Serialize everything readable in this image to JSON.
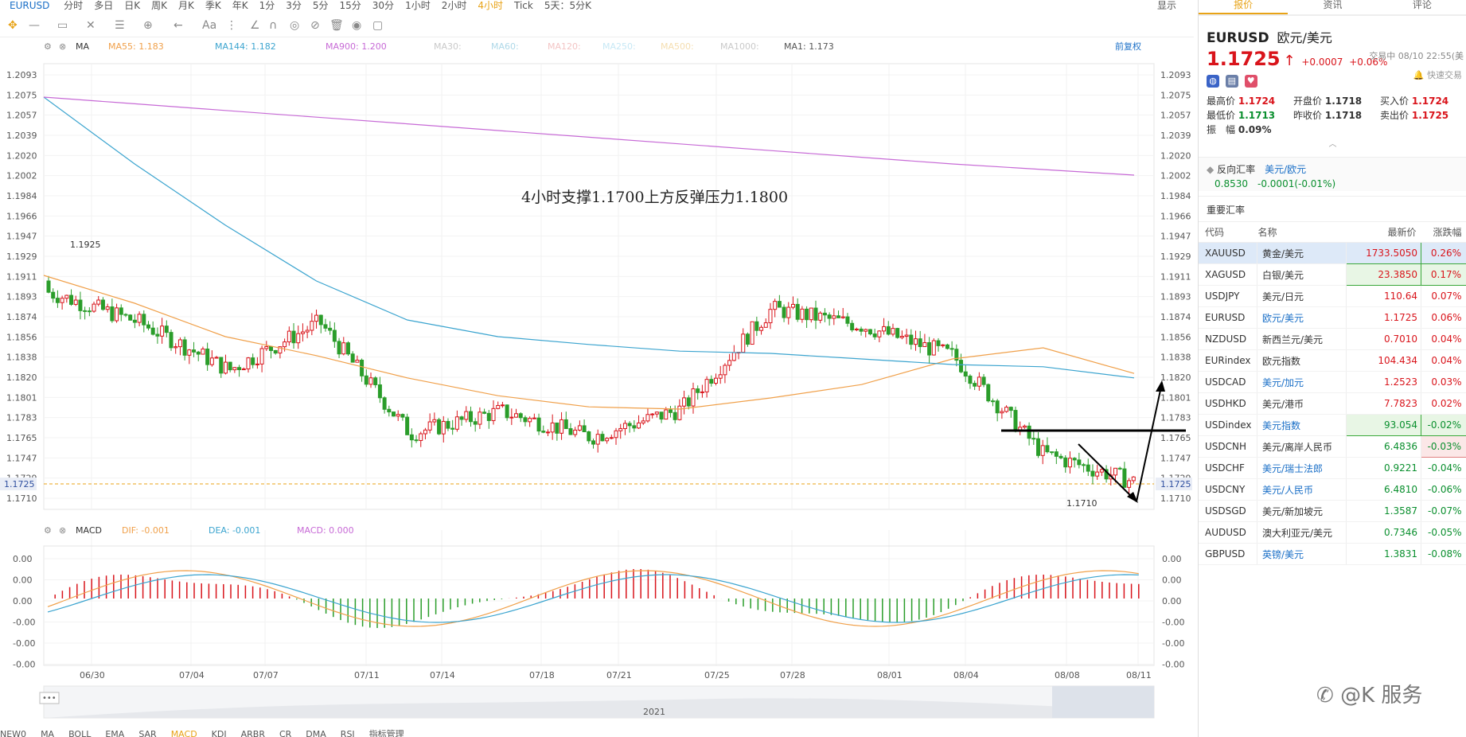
{
  "toolbar": {
    "symbol": "EURUSD",
    "periods": [
      "分时",
      "多日",
      "日K",
      "周K",
      "月K",
      "季K",
      "年K",
      "1分",
      "3分",
      "5分",
      "15分",
      "30分",
      "1小时",
      "2小时",
      "4小时",
      "Tick",
      "5天：5分K"
    ],
    "active_period": "4小时",
    "display_label": "显示"
  },
  "chart": {
    "ma_label": "MA",
    "ma55": "MA55: 1.183",
    "ma144": "MA144: 1.182",
    "ma900": "MA900: 1.200",
    "ma30": "MA30:",
    "ma60": "MA60:",
    "ma120": "MA120:",
    "ma250": "MA250:",
    "ma500": "MA500:",
    "ma1000": "MA1000:",
    "ma1": "MA1: 1.173",
    "adjust_label": "前复权",
    "annotation": "4小时支撑1.1700上方反弹压力1.1800",
    "price_ticks": [
      "1.2093",
      "1.2075",
      "1.2057",
      "1.2039",
      "1.2020",
      "1.2002",
      "1.1984",
      "1.1966",
      "1.1947",
      "1.1929",
      "1.1911",
      "1.1893",
      "1.1874",
      "1.1856",
      "1.1838",
      "1.1820",
      "1.1801",
      "1.1783",
      "1.1765",
      "1.1747",
      "1.1729",
      "1.1710"
    ],
    "current_price": "1.1725",
    "high_label": "1.1925",
    "low_label": "1.1710",
    "date_ticks": [
      "06/30",
      "07/04",
      "07/07",
      "07/11",
      "07/14",
      "07/18",
      "07/21",
      "07/25",
      "07/28",
      "08/01",
      "08/04",
      "08/08",
      "08/11"
    ],
    "year_label": "2021",
    "macd_label": "MACD",
    "dif": "DIF: -0.001",
    "dea": "DEA: -0.001",
    "macd": "MACD: 0.000",
    "macd_ticks": [
      "0.00",
      "0.00",
      "0.00",
      "-0.00",
      "-0.00",
      "-0.00"
    ]
  },
  "chart_data": {
    "type": "candlestick",
    "symbol": "EURUSD",
    "ylim": [
      1.17,
      1.21
    ],
    "x": [
      "06/30",
      "07/04",
      "07/07",
      "07/11",
      "07/14",
      "07/18",
      "07/21",
      "07/25",
      "07/28",
      "08/01",
      "08/04",
      "08/08",
      "08/11"
    ],
    "close": [
      1.1895,
      1.1868,
      1.1825,
      1.1868,
      1.1768,
      1.1788,
      1.1765,
      1.179,
      1.188,
      1.1865,
      1.1838,
      1.175,
      1.1725
    ],
    "series": [
      {
        "name": "MA55",
        "values": [
          1.191,
          1.1885,
          1.1855,
          1.1838,
          1.1818,
          1.1802,
          1.1792,
          1.179,
          1.18,
          1.1812,
          1.1835,
          1.1845,
          1.1822
        ]
      },
      {
        "name": "MA144",
        "values": [
          1.207,
          1.201,
          1.1955,
          1.1905,
          1.187,
          1.1855,
          1.1848,
          1.1842,
          1.184,
          1.1835,
          1.183,
          1.1828,
          1.1818
        ]
      },
      {
        "name": "MA900",
        "values": [
          1.207,
          1.2064,
          1.2058,
          1.2052,
          1.2046,
          1.204,
          1.2034,
          1.2028,
          1.2022,
          1.2016,
          1.201,
          1.2005,
          1.2
        ]
      }
    ],
    "colors": {
      "up": "#d9141b",
      "down": "#2a9d2a",
      "ma55": "#f0a04a",
      "ma144": "#3ba4cf",
      "ma900": "#c76ad6",
      "ma1": "#f5c542"
    }
  },
  "bottombar": [
    "NEW0",
    "MA",
    "BOLL",
    "EMA",
    "SAR",
    "MACD",
    "KDJ",
    "ARBR",
    "CR",
    "DMA",
    "RSI",
    "指标管理"
  ],
  "bottom_active": "MACD",
  "panel": {
    "tabs": [
      "报价",
      "资讯",
      "评论"
    ],
    "active_tab": "报价",
    "symbol": "EURUSD",
    "name": "欧元/美元",
    "price": "1.1725",
    "change": "+0.0007",
    "change_pct": "+0.06%",
    "time": "交易中 08/10 22:55(美",
    "fast_trade": "快速交易",
    "stats": [
      {
        "k": "最高价",
        "v": "1.1724",
        "c": "red"
      },
      {
        "k": "开盘价",
        "v": "1.1718",
        "c": "black"
      },
      {
        "k": "买入价",
        "v": "1.1724",
        "c": "red"
      },
      {
        "k": "最低价",
        "v": "1.1713",
        "c": "green"
      },
      {
        "k": "昨收价",
        "v": "1.1718",
        "c": "black"
      },
      {
        "k": "卖出价",
        "v": "1.1725",
        "c": "red"
      }
    ],
    "amp_label": "振　幅",
    "amp": "0.09%",
    "reverse_label": "反向汇率",
    "reverse_pair": "美元/欧元",
    "reverse_price": "0.8530",
    "reverse_change": "-0.0001(-0.01%)",
    "rates_title": "重要汇率",
    "table_headers": [
      "代码",
      "名称",
      "最新价",
      "涨跌幅"
    ],
    "rates": [
      {
        "code": "XAUUSD",
        "name": "黄金/美元",
        "price": "1733.5050",
        "pct": "0.26%",
        "dir": "up",
        "link": false
      },
      {
        "code": "XAGUSD",
        "name": "白银/美元",
        "price": "23.3850",
        "pct": "0.17%",
        "dir": "up",
        "link": false
      },
      {
        "code": "USDJPY",
        "name": "美元/日元",
        "price": "110.64",
        "pct": "0.07%",
        "dir": "up",
        "link": false
      },
      {
        "code": "EURUSD",
        "name": "欧元/美元",
        "price": "1.1725",
        "pct": "0.06%",
        "dir": "up",
        "link": true
      },
      {
        "code": "NZDUSD",
        "name": "新西兰元/美元",
        "price": "0.7010",
        "pct": "0.04%",
        "dir": "up",
        "link": false
      },
      {
        "code": "EURindex",
        "name": "欧元指数",
        "price": "104.434",
        "pct": "0.04%",
        "dir": "up",
        "link": false
      },
      {
        "code": "USDCAD",
        "name": "美元/加元",
        "price": "1.2523",
        "pct": "0.03%",
        "dir": "up",
        "link": true
      },
      {
        "code": "USDHKD",
        "name": "美元/港币",
        "price": "7.7823",
        "pct": "0.02%",
        "dir": "up",
        "link": false
      },
      {
        "code": "USDindex",
        "name": "美元指数",
        "price": "93.054",
        "pct": "-0.02%",
        "dir": "down",
        "link": true
      },
      {
        "code": "USDCNH",
        "name": "美元/离岸人民币",
        "price": "6.4836",
        "pct": "-0.03%",
        "dir": "down",
        "link": false
      },
      {
        "code": "USDCHF",
        "name": "美元/瑞士法郎",
        "price": "0.9221",
        "pct": "-0.04%",
        "dir": "down",
        "link": true
      },
      {
        "code": "USDCNY",
        "name": "美元/人民币",
        "price": "6.4810",
        "pct": "-0.06%",
        "dir": "down",
        "link": true
      },
      {
        "code": "USDSGD",
        "name": "美元/新加坡元",
        "price": "1.3587",
        "pct": "-0.07%",
        "dir": "down",
        "link": false
      },
      {
        "code": "AUDUSD",
        "name": "澳大利亚元/美元",
        "price": "0.7346",
        "pct": "-0.05%",
        "dir": "down",
        "link": false
      },
      {
        "code": "GBPUSD",
        "name": "英镑/美元",
        "price": "1.3831",
        "pct": "-0.08%",
        "dir": "down",
        "link": true
      }
    ]
  },
  "watermark": "@K 服务"
}
